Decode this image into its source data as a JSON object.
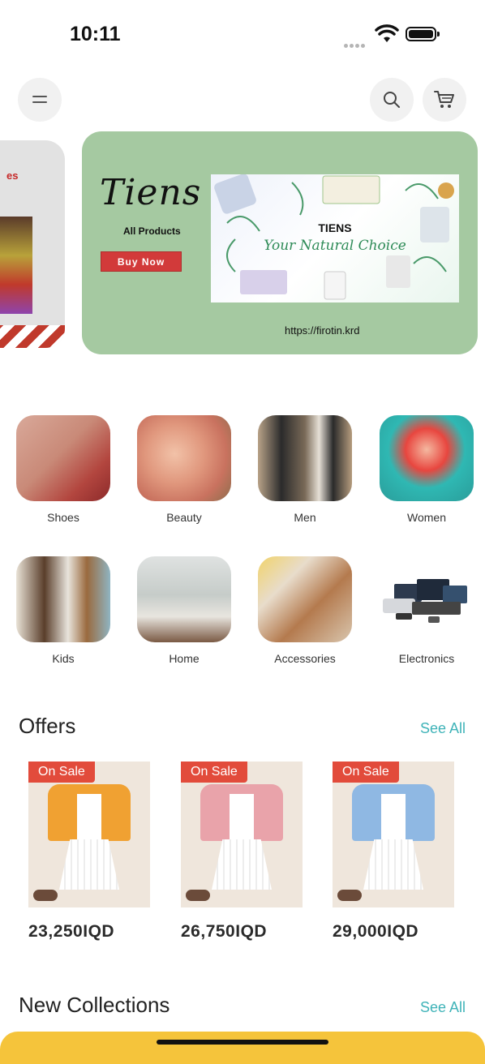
{
  "status_bar": {
    "time": "10:11"
  },
  "header": {
    "menu_icon": "menu-icon",
    "search_icon": "search-icon",
    "cart_icon": "cart-icon"
  },
  "banners": {
    "partial_left": {
      "text": "es"
    },
    "main": {
      "brand_script": "Tiens",
      "subtitle": "All Products",
      "cta": "Buy Now",
      "image_brand": "TIENS",
      "image_slogan": "Your Natural Choice",
      "url": "https://firotin.krd",
      "background": "#a5c9a1"
    }
  },
  "categories": [
    {
      "label": "Shoes",
      "icon": "shoes-image"
    },
    {
      "label": "Beauty",
      "icon": "beauty-image"
    },
    {
      "label": "Men",
      "icon": "men-image"
    },
    {
      "label": "Women",
      "icon": "women-image"
    },
    {
      "label": "Kids",
      "icon": "kids-image"
    },
    {
      "label": "Home",
      "icon": "home-image"
    },
    {
      "label": "Accessories",
      "icon": "accessories-image"
    },
    {
      "label": "Electronics",
      "icon": "electronics-image"
    }
  ],
  "offers": {
    "title": "Offers",
    "see_all": "See All",
    "items": [
      {
        "badge": "On Sale",
        "price": "23,250IQD",
        "color": "#f0a132"
      },
      {
        "badge": "On Sale",
        "price": "26,750IQD",
        "color": "#e9a3aa"
      },
      {
        "badge": "On Sale",
        "price": "29,000IQD",
        "color": "#8fb8e3"
      }
    ]
  },
  "new_collections": {
    "title": "New Collections",
    "see_all": "See All"
  },
  "colors": {
    "accent": "#3fb3b8",
    "sale": "#e24b3b",
    "cta": "#d23a3a"
  }
}
